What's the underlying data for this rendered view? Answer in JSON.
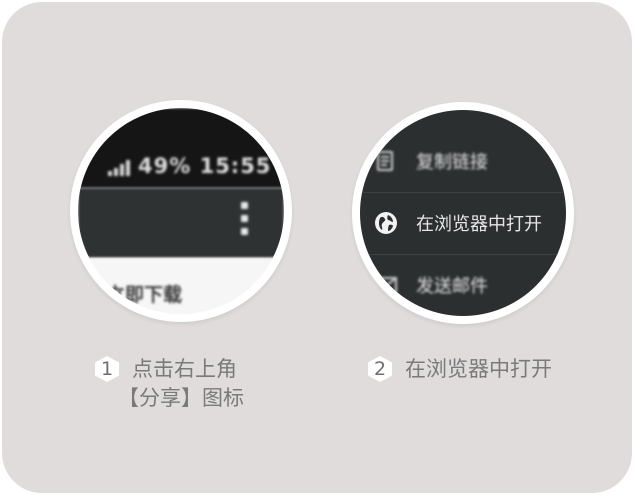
{
  "step1": {
    "number": "1",
    "line1": "点击右上角",
    "line2": "【分享】图标",
    "status_text": "49%  15:55",
    "page_text": "立即下载"
  },
  "step2": {
    "number": "2",
    "caption": "在浏览器中打开",
    "menu": [
      {
        "icon": "copy-icon",
        "label": "复制链接"
      },
      {
        "icon": "globe-icon",
        "label": "在浏览器中打开"
      },
      {
        "icon": "mail-icon",
        "label": "发送邮件"
      }
    ]
  },
  "colors": {
    "card_background": "#e0dcdb",
    "dark_toolbar": "#2e3233",
    "status_bar": "#151515",
    "caption_text": "#7a7a7a"
  }
}
